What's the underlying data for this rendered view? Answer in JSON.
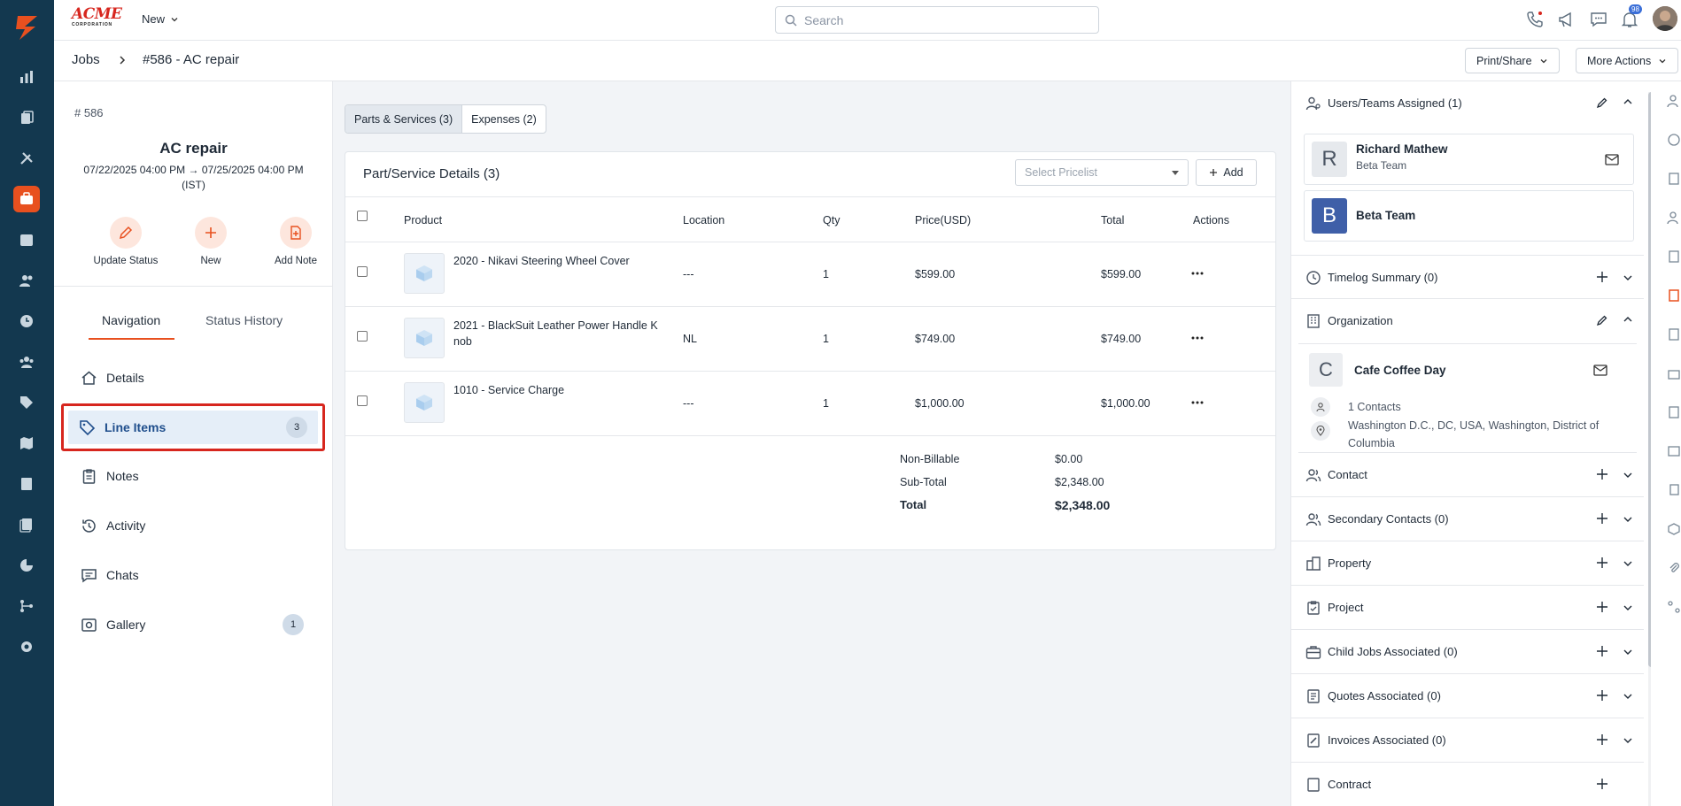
{
  "topbar": {
    "logo_text": "ACME",
    "logo_sub": "CORPORATION",
    "new_label": "New",
    "search_placeholder": "Search",
    "notifications_count": "98"
  },
  "breadcrumb": {
    "root": "Jobs",
    "current": "#586 - AC repair",
    "print_share": "Print/Share",
    "more_actions": "More Actions"
  },
  "job": {
    "number": "# 586",
    "name": "AC repair",
    "dates": "07/22/2025 04:00 PM → 07/25/2025 04:00 PM (IST)",
    "actions": [
      "Update Status",
      "New",
      "Add Note"
    ]
  },
  "nav": {
    "tabs": [
      "Navigation",
      "Status History"
    ],
    "items": [
      {
        "label": "Details",
        "count": ""
      },
      {
        "label": "Line Items",
        "count": "3"
      },
      {
        "label": "Notes",
        "count": ""
      },
      {
        "label": "Activity",
        "count": ""
      },
      {
        "label": "Chats",
        "count": ""
      },
      {
        "label": "Gallery",
        "count": "1"
      }
    ]
  },
  "center": {
    "subtabs": [
      "Parts & Services (3)",
      "Expenses (2)"
    ],
    "card_title": "Part/Service Details (3)",
    "pricelist_placeholder": "Select Pricelist",
    "add_label": "Add",
    "columns": [
      "Product",
      "Location",
      "Qty",
      "Price(USD)",
      "Total",
      "Actions"
    ],
    "rows": [
      {
        "product": "2020 - Nikavi Steering Wheel Cover",
        "location": "---",
        "qty": "1",
        "price": "$599.00",
        "total": "$599.00"
      },
      {
        "product": "2021 - BlackSuit Leather Power Handle K nob",
        "location": "NL",
        "qty": "1",
        "price": "$749.00",
        "total": "$749.00"
      },
      {
        "product": "1010 - Service Charge",
        "location": "---",
        "qty": "1",
        "price": "$1,000.00",
        "total": "$1,000.00"
      }
    ],
    "summary": [
      {
        "label": "Non-Billable",
        "value": "$0.00"
      },
      {
        "label": "Sub-Total",
        "value": "$2,348.00"
      },
      {
        "label": "Total",
        "value": "$2,348.00"
      }
    ]
  },
  "right": {
    "users_title": "Users/Teams Assigned (1)",
    "user_initial": "R",
    "user_name": "Richard Mathew",
    "user_team": "Beta Team",
    "team_initial": "B",
    "team_name": "Beta Team",
    "timelog_title": "Timelog Summary (0)",
    "org_title": "Organization",
    "org_initial": "C",
    "org_name": "Cafe Coffee Day",
    "org_contacts": "1 Contacts",
    "org_address": "Washington D.C., DC, USA, Washington, District of Columbia",
    "sections": [
      "Contact",
      "Secondary Contacts (0)",
      "Property",
      "Project",
      "Child Jobs Associated (0)",
      "Quotes Associated (0)",
      "Invoices Associated (0)",
      "Contract"
    ]
  },
  "colors": {
    "rail": "#13384f",
    "accent": "#e8501f",
    "highlight_border": "#d7261e",
    "user_avatar_bg": "#e6e9ed",
    "team_avatar_bg": "#3f5fa8"
  }
}
